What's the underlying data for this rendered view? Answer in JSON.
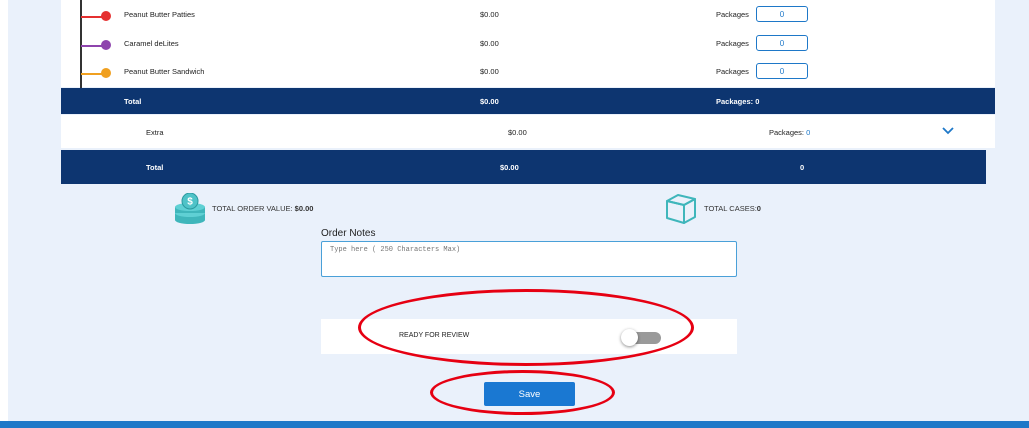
{
  "products": [
    {
      "name": "Peanut Butter Patties",
      "price": "$0.00",
      "packages_label": "Packages",
      "packages_value": "0",
      "dot_color": "#e53030"
    },
    {
      "name": "Caramel deLites",
      "price": "$0.00",
      "packages_label": "Packages",
      "packages_value": "0",
      "dot_color": "#8e44ad"
    },
    {
      "name": "Peanut Butter Sandwich",
      "price": "$0.00",
      "packages_label": "Packages",
      "packages_value": "0",
      "dot_color": "#f0a020"
    }
  ],
  "group_total": {
    "label": "Total",
    "value": "$0.00",
    "packages": "Packages: 0"
  },
  "extra": {
    "label": "Extra",
    "value": "$0.00",
    "packages_label": "Packages:",
    "packages_count": "0"
  },
  "grand_total": {
    "label": "Total",
    "value": "$0.00",
    "count": "0"
  },
  "summary": {
    "order_value_label": "TOTAL ORDER VALUE:",
    "order_value": "$0.00",
    "cases_label": "TOTAL CASES:",
    "cases_value": "0"
  },
  "notes": {
    "title": "Order Notes",
    "placeholder": "Type here ( 250 Characters Max)"
  },
  "review": {
    "label": "READY FOR REVIEW",
    "toggle_on": false
  },
  "save_label": "Save",
  "colors": {
    "navy": "#0d3570",
    "accent": "#1e78c8",
    "annotation": "#e60012",
    "icon_teal": "#4fc3c8"
  }
}
